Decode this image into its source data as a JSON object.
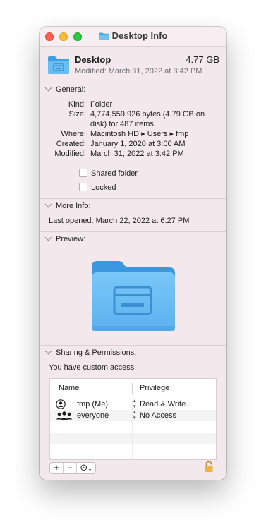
{
  "window": {
    "title": "Desktop Info"
  },
  "header": {
    "name": "Desktop",
    "size": "4.77 GB",
    "modified": "Modified: March 31, 2022 at 3:42 PM"
  },
  "general": {
    "heading": "General:",
    "rows": [
      {
        "key": "Kind:",
        "value": "Folder"
      },
      {
        "key": "Size:",
        "value": "4,774,559,926 bytes (4.79 GB on disk) for 487 items"
      },
      {
        "key": "Where:",
        "value": "Macintosh HD ▸ Users ▸ fmp"
      },
      {
        "key": "Created:",
        "value": "January 1, 2020 at 3:00 AM"
      },
      {
        "key": "Modified:",
        "value": "March 31, 2022 at 3:42 PM"
      }
    ],
    "shared_folder_label": "Shared folder",
    "shared_folder_checked": false,
    "locked_label": "Locked",
    "locked_checked": false
  },
  "more_info": {
    "heading": "More Info:",
    "last_opened": "Last opened: March 22, 2022 at 6:27 PM"
  },
  "preview": {
    "heading": "Preview:"
  },
  "sharing": {
    "heading": "Sharing & Permissions:",
    "access_text": "You have custom access",
    "col_name": "Name",
    "col_privilege": "Privilege",
    "rows": [
      {
        "name": "fmp (Me)",
        "privilege": "Read & Write",
        "icon": "user-icon"
      },
      {
        "name": "everyone",
        "privilege": "No Access",
        "icon": "group-icon"
      }
    ]
  },
  "toolbar": {
    "add": "+",
    "remove": "−",
    "action": "⊙"
  },
  "colors": {
    "folder_blue": "#5fb6ef",
    "accent": "#1d7ce0"
  }
}
